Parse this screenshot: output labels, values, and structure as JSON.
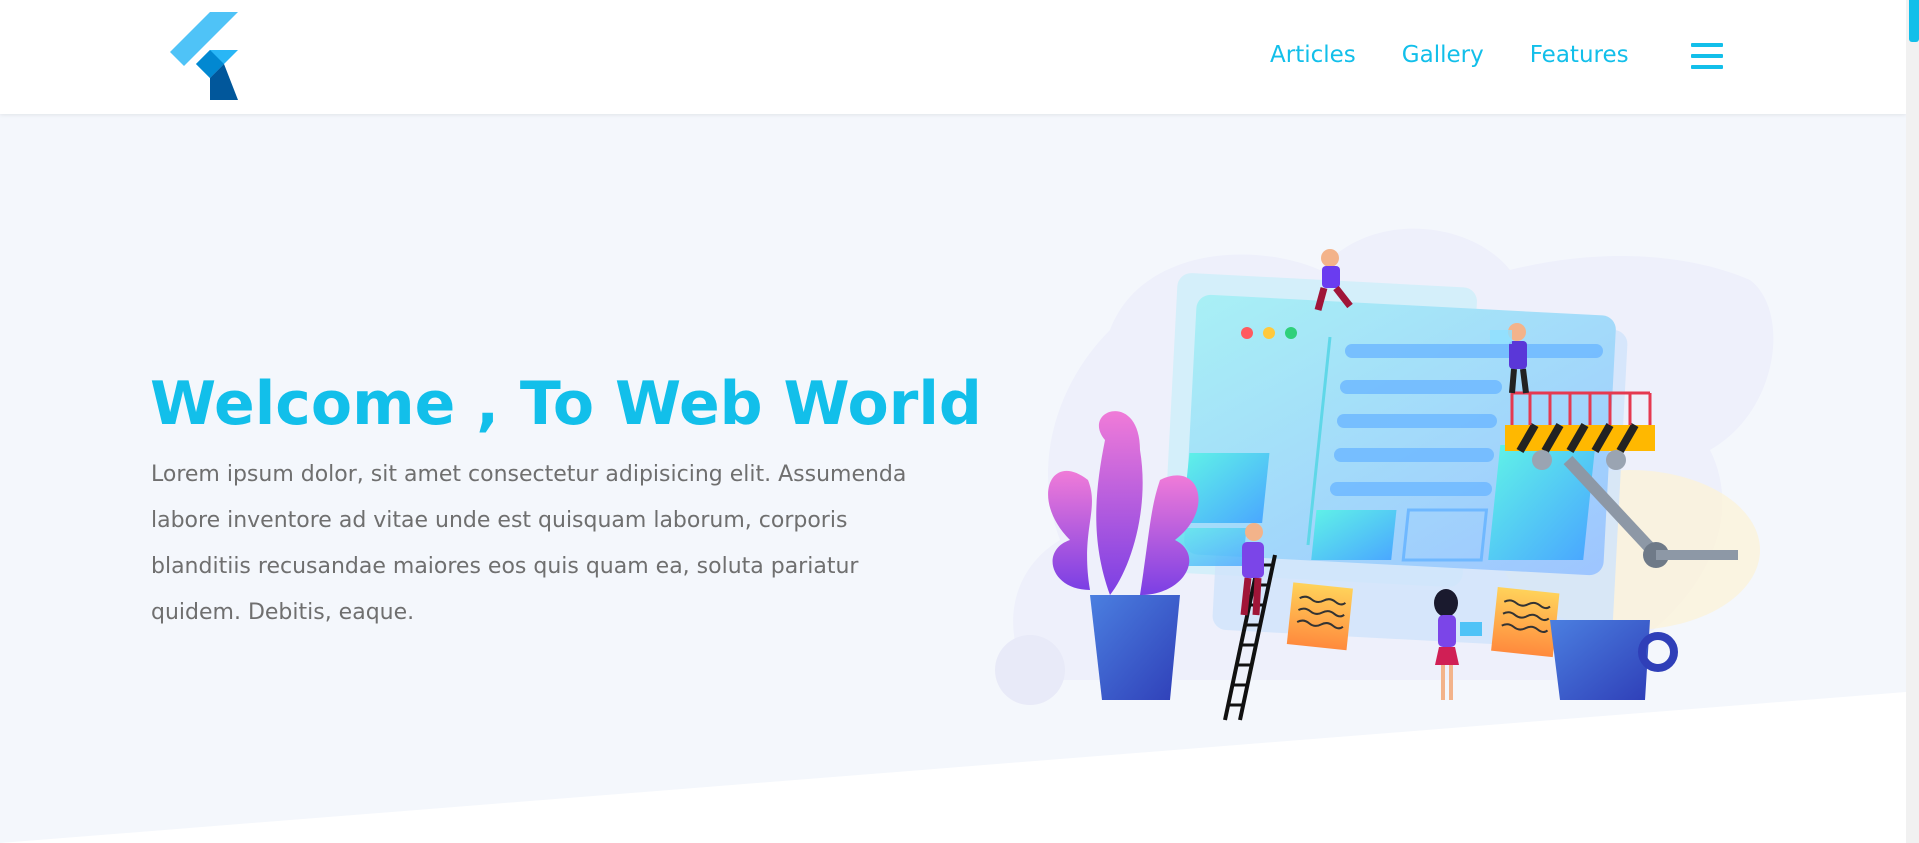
{
  "navbar": {
    "links": [
      "Articles",
      "Gallery",
      "Features"
    ]
  },
  "hero": {
    "title": "Welcome , To Web World",
    "text": "Lorem ipsum dolor, sit amet consectetur adipisicing elit. Assumenda labore inventore ad vitae unde est quisquam laborum, corporis blanditiis recusandae maiores eos quis quam ea, soluta pariatur quidem. Debitis, eaque."
  },
  "colors": {
    "accent": "#12bfea",
    "background": "#f4f7fc",
    "text": "#6f6f6f"
  },
  "icons": {
    "logo": "flutter-logo-icon",
    "menu": "hamburger-menu-icon"
  }
}
